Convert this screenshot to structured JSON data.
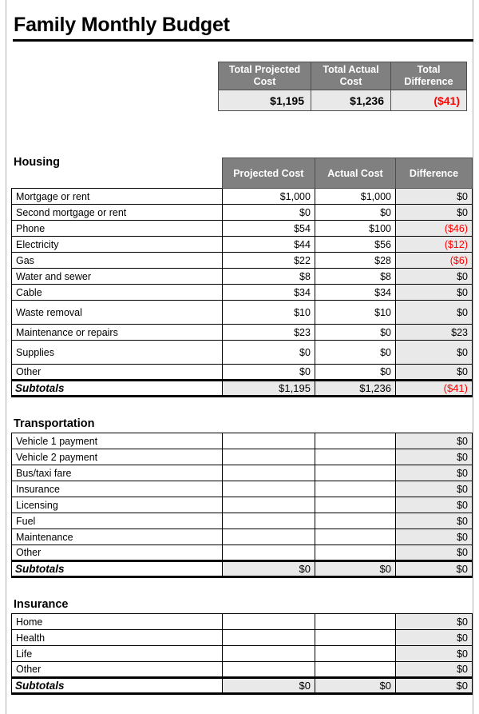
{
  "document": {
    "title": "Family Monthly Budget"
  },
  "colors": {
    "header_gray": "#808080",
    "shade_gray": "#e9e9e9",
    "negative_red": "#ff0000",
    "rule_black": "#000000"
  },
  "summary": {
    "headers": [
      "Total Projected Cost",
      "Total Actual Cost",
      "Total Difference"
    ],
    "values": [
      "$1,195",
      "$1,236",
      "($41)"
    ],
    "value_is_negative": [
      false,
      false,
      true
    ]
  },
  "column_headers": [
    "Projected Cost",
    "Actual Cost",
    "Difference"
  ],
  "subtotals_label": "Subtotals",
  "sections": [
    {
      "name": "Housing",
      "rows": [
        {
          "item": "Mortgage or rent",
          "projected": "$1,000",
          "actual": "$1,000",
          "difference": "$0",
          "negative": false,
          "tall": false
        },
        {
          "item": "Second mortgage or rent",
          "projected": "$0",
          "actual": "$0",
          "difference": "$0",
          "negative": false,
          "tall": false
        },
        {
          "item": "Phone",
          "projected": "$54",
          "actual": "$100",
          "difference": "($46)",
          "negative": true,
          "tall": false
        },
        {
          "item": "Electricity",
          "projected": "$44",
          "actual": "$56",
          "difference": "($12)",
          "negative": true,
          "tall": false
        },
        {
          "item": "Gas",
          "projected": "$22",
          "actual": "$28",
          "difference": "($6)",
          "negative": true,
          "tall": false
        },
        {
          "item": "Water and sewer",
          "projected": "$8",
          "actual": "$8",
          "difference": "$0",
          "negative": false,
          "tall": false
        },
        {
          "item": "Cable",
          "projected": "$34",
          "actual": "$34",
          "difference": "$0",
          "negative": false,
          "tall": false
        },
        {
          "item": "Waste removal",
          "projected": "$10",
          "actual": "$10",
          "difference": "$0",
          "negative": false,
          "tall": true
        },
        {
          "item": "Maintenance or repairs",
          "projected": "$23",
          "actual": "$0",
          "difference": "$23",
          "negative": false,
          "tall": false
        },
        {
          "item": "Supplies",
          "projected": "$0",
          "actual": "$0",
          "difference": "$0",
          "negative": false,
          "tall": true
        },
        {
          "item": "Other",
          "projected": "$0",
          "actual": "$0",
          "difference": "$0",
          "negative": false,
          "tall": false
        }
      ],
      "subtotals": {
        "projected": "$1,195",
        "actual": "$1,236",
        "difference": "($41)",
        "negative": true
      }
    },
    {
      "name": "Transportation",
      "rows": [
        {
          "item": "Vehicle 1 payment",
          "projected": "",
          "actual": "",
          "difference": "$0",
          "negative": false,
          "tall": false
        },
        {
          "item": "Vehicle 2 payment",
          "projected": "",
          "actual": "",
          "difference": "$0",
          "negative": false,
          "tall": false
        },
        {
          "item": "Bus/taxi fare",
          "projected": "",
          "actual": "",
          "difference": "$0",
          "negative": false,
          "tall": false
        },
        {
          "item": "Insurance",
          "projected": "",
          "actual": "",
          "difference": "$0",
          "negative": false,
          "tall": false
        },
        {
          "item": "Licensing",
          "projected": "",
          "actual": "",
          "difference": "$0",
          "negative": false,
          "tall": false
        },
        {
          "item": "Fuel",
          "projected": "",
          "actual": "",
          "difference": "$0",
          "negative": false,
          "tall": false
        },
        {
          "item": "Maintenance",
          "projected": "",
          "actual": "",
          "difference": "$0",
          "negative": false,
          "tall": false
        },
        {
          "item": "Other",
          "projected": "",
          "actual": "",
          "difference": "$0",
          "negative": false,
          "tall": false
        }
      ],
      "subtotals": {
        "projected": "$0",
        "actual": "$0",
        "difference": "$0",
        "negative": false
      }
    },
    {
      "name": "Insurance",
      "rows": [
        {
          "item": "Home",
          "projected": "",
          "actual": "",
          "difference": "$0",
          "negative": false,
          "tall": false
        },
        {
          "item": "Health",
          "projected": "",
          "actual": "",
          "difference": "$0",
          "negative": false,
          "tall": false
        },
        {
          "item": "Life",
          "projected": "",
          "actual": "",
          "difference": "$0",
          "negative": false,
          "tall": false
        },
        {
          "item": "Other",
          "projected": "",
          "actual": "",
          "difference": "$0",
          "negative": false,
          "tall": false
        }
      ],
      "subtotals": {
        "projected": "$0",
        "actual": "$0",
        "difference": "$0",
        "negative": false
      }
    }
  ]
}
